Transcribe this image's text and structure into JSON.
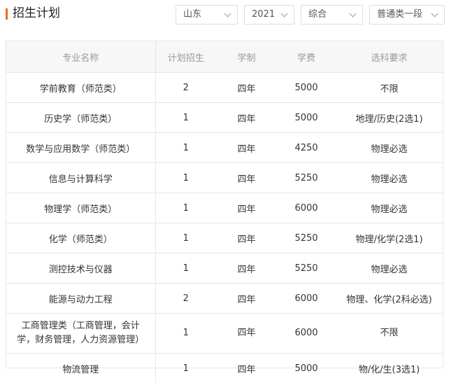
{
  "header": {
    "title": "招生计划"
  },
  "filters": [
    {
      "name": "province-select",
      "value": "山东"
    },
    {
      "name": "year-select",
      "value": "2021"
    },
    {
      "name": "type-select",
      "value": "综合"
    },
    {
      "name": "batch-select",
      "value": "普通类一段"
    }
  ],
  "table": {
    "headers": [
      "专业名称",
      "计划招生",
      "学制",
      "学费",
      "选科要求"
    ],
    "rows": [
      {
        "major": "学前教育（师范类）",
        "plan": "2",
        "duration": "四年",
        "fee": "5000",
        "requirement": "不限"
      },
      {
        "major": "历史学（师范类）",
        "plan": "1",
        "duration": "四年",
        "fee": "5000",
        "requirement": "地理/历史(2选1)"
      },
      {
        "major": "数学与应用数学（师范类）",
        "plan": "1",
        "duration": "四年",
        "fee": "4250",
        "requirement": "物理必选"
      },
      {
        "major": "信息与计算科学",
        "plan": "1",
        "duration": "四年",
        "fee": "5250",
        "requirement": "物理必选"
      },
      {
        "major": "物理学（师范类）",
        "plan": "1",
        "duration": "四年",
        "fee": "6000",
        "requirement": "物理必选"
      },
      {
        "major": "化学（师范类）",
        "plan": "1",
        "duration": "四年",
        "fee": "5250",
        "requirement": "物理/化学(2选1)"
      },
      {
        "major": "测控技术与仪器",
        "plan": "1",
        "duration": "四年",
        "fee": "5250",
        "requirement": "物理必选"
      },
      {
        "major": "能源与动力工程",
        "plan": "2",
        "duration": "四年",
        "fee": "6000",
        "requirement": "物理、化学(2科必选)"
      },
      {
        "major": "工商管理类（工商管理，会计学，财务管理，人力资源管理）",
        "plan": "1",
        "duration": "四年",
        "fee": "6000",
        "requirement": "不限"
      },
      {
        "major": "物流管理",
        "plan": "1",
        "duration": "四年",
        "fee": "5000",
        "requirement": "物/化/生(3选1)"
      }
    ]
  }
}
